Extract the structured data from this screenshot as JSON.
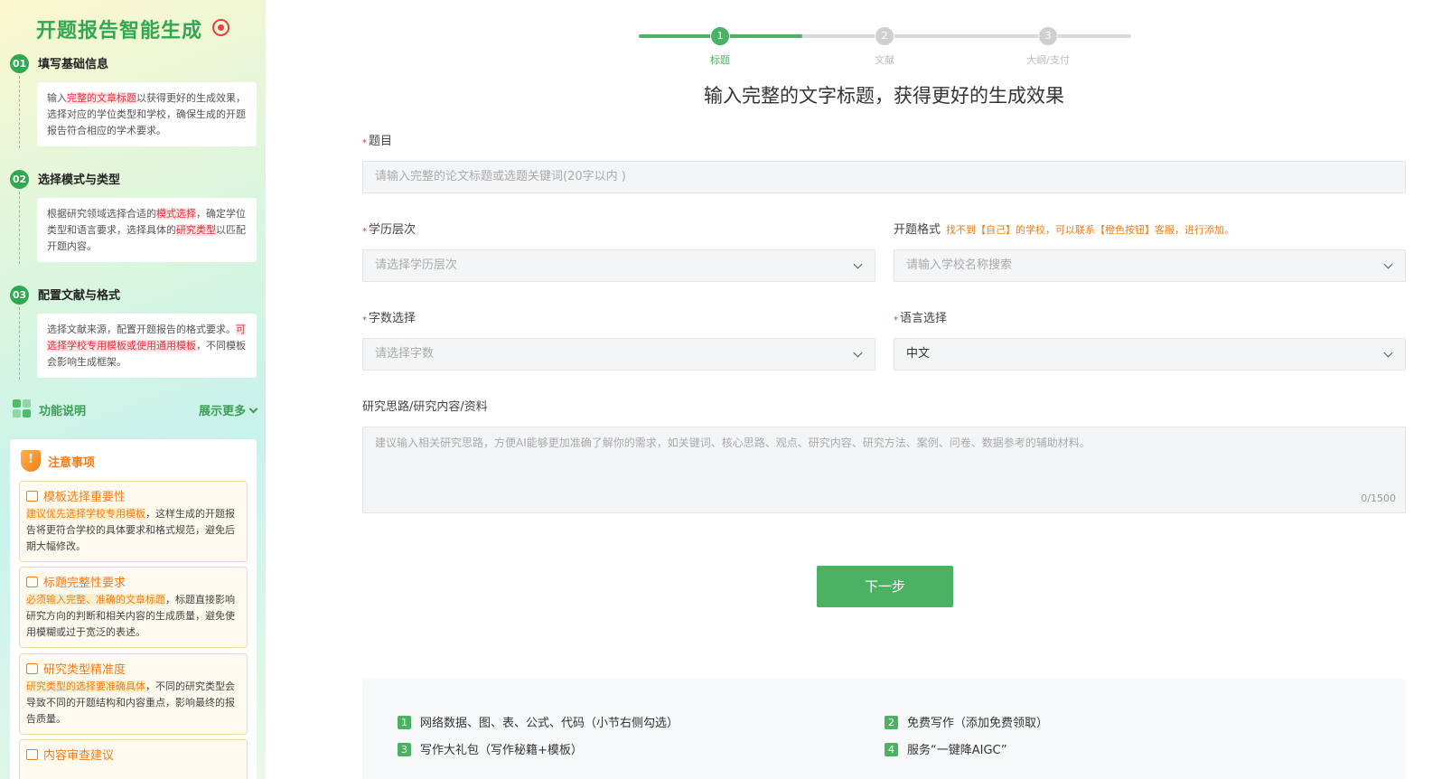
{
  "sidebar": {
    "title": "开题报告智能生成",
    "steps": [
      {
        "num": "01",
        "title": "填写基础信息",
        "text_a": "输入",
        "highlight": "完整的文章标题",
        "text_b": "以获得更好的生成效果，选择对应的学位类型和学校，确保生成的开题报告符合相应的学术要求。"
      },
      {
        "num": "02",
        "title": "选择模式与类型",
        "text_a": "根据研究领域选择合适的",
        "highlight": "模式选择",
        "text_b": "，确定学位类型和语言要求，选择具体的",
        "highlight2": "研究类型",
        "text_c": "以匹配开题内容。"
      },
      {
        "num": "03",
        "title": "配置文献与格式",
        "text_a": "选择文献来源，配置开题报告的格式要求。",
        "highlight": "可选择学校专用模板或使用通用模板",
        "text_b": "，不同模板会影响生成框架。"
      }
    ],
    "func_label": "功能说明",
    "more_label": "展示更多",
    "notes_title": "注意事项",
    "notes": [
      {
        "title": "模板选择重要性",
        "highlight": "建议优先选择学校专用模板",
        "text": "，这样生成的开题报告将更符合学校的具体要求和格式规范，避免后期大幅修改。"
      },
      {
        "title": "标题完整性要求",
        "highlight": "必须输入完整、准确的文章标题",
        "text": "，标题直接影响研究方向的判断和相关内容的生成质量，避免使用模糊或过于宽泛的表述。"
      },
      {
        "title": "研究类型精准度",
        "highlight": "研究类型的选择要准确具体",
        "text": "，不同的研究类型会导致不同的开题结构和内容重点，影响最终的报告质量。"
      },
      {
        "title": "内容审查建议",
        "highlight": "",
        "text": ""
      }
    ]
  },
  "progress": {
    "fill_fraction": 0.333,
    "steps": [
      {
        "num": "1",
        "label": "标题",
        "active": true
      },
      {
        "num": "2",
        "label": "文献",
        "active": false
      },
      {
        "num": "3",
        "label": "大纲/支付",
        "active": false
      }
    ]
  },
  "form": {
    "headline": "输入完整的文字标题，获得更好的生成效果",
    "required_mark": "*",
    "title_label": "题目",
    "title_placeholder": "请输入完整的论文标题或选题关键词(20字以内 )",
    "degree_label": "学历层次",
    "degree_placeholder": "请选择学历层次",
    "format_label": "开题格式",
    "format_tip": "找不到【自己】的学校，可以联系【橙色按钮】客服，进行添加。",
    "school_placeholder": "请输入学校名称搜索",
    "words_label": "字数选择",
    "words_placeholder": "请选择字数",
    "lang_label": "语言选择",
    "lang_value": "中文",
    "research_label": "研究思路/研究内容/资料",
    "research_placeholder": "建议输入相关研究思路，方便AI能够更加准确了解你的需求，如关键词、核心思路、观点、研究内容、研究方法、案例、问卷、数据参考的辅助材料。",
    "counter": "0/1500",
    "next_label": "下一步"
  },
  "bonus": [
    {
      "num": "1",
      "text": "网络数据、图、表、公式、代码（小节右侧勾选）"
    },
    {
      "num": "2",
      "text": "免费写作（添加免费领取）"
    },
    {
      "num": "3",
      "text": "写作大礼包（写作秘籍+模板）"
    },
    {
      "num": "4",
      "text": "服务“一键降AIGC”"
    }
  ]
}
